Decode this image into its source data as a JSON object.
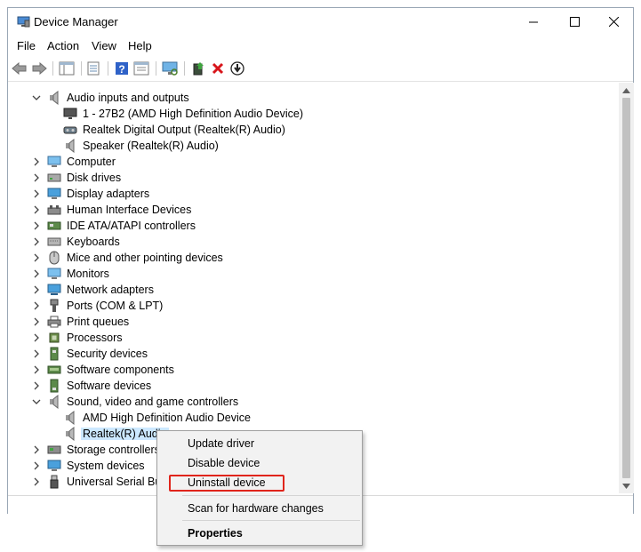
{
  "window": {
    "title": "Device Manager"
  },
  "menu": [
    "File",
    "Action",
    "View",
    "Help"
  ],
  "toolbar": {
    "icons": [
      "back-arrow-icon",
      "forward-arrow-icon",
      "show-hide-console-tree-icon",
      "properties-icon",
      "help-icon",
      "view-icon",
      "monitor-scan-icon",
      "update-driver-icon",
      "uninstall-icon",
      "disable-icon"
    ]
  },
  "tree": [
    {
      "label": "Audio inputs and outputs",
      "level": 0,
      "expanded": true,
      "icon": "speaker-icon"
    },
    {
      "label": "1 - 27B2 (AMD High Definition Audio Device)",
      "level": 1,
      "icon": "monitor-audio-icon"
    },
    {
      "label": "Realtek Digital Output (Realtek(R) Audio)",
      "level": 1,
      "icon": "digital-output-icon"
    },
    {
      "label": "Speaker (Realtek(R) Audio)",
      "level": 1,
      "icon": "speaker-icon"
    },
    {
      "label": "Computer",
      "level": 0,
      "expanded": false,
      "icon": "computer-icon"
    },
    {
      "label": "Disk drives",
      "level": 0,
      "expanded": false,
      "icon": "disk-drive-icon"
    },
    {
      "label": "Display adapters",
      "level": 0,
      "expanded": false,
      "icon": "display-adapter-icon"
    },
    {
      "label": "Human Interface Devices",
      "level": 0,
      "expanded": false,
      "icon": "hid-icon"
    },
    {
      "label": "IDE ATA/ATAPI controllers",
      "level": 0,
      "expanded": false,
      "icon": "ide-controller-icon"
    },
    {
      "label": "Keyboards",
      "level": 0,
      "expanded": false,
      "icon": "keyboard-icon"
    },
    {
      "label": "Mice and other pointing devices",
      "level": 0,
      "expanded": false,
      "icon": "mouse-icon"
    },
    {
      "label": "Monitors",
      "level": 0,
      "expanded": false,
      "icon": "monitor-icon"
    },
    {
      "label": "Network adapters",
      "level": 0,
      "expanded": false,
      "icon": "network-adapter-icon"
    },
    {
      "label": "Ports (COM & LPT)",
      "level": 0,
      "expanded": false,
      "icon": "port-icon"
    },
    {
      "label": "Print queues",
      "level": 0,
      "expanded": false,
      "icon": "printer-icon"
    },
    {
      "label": "Processors",
      "level": 0,
      "expanded": false,
      "icon": "processor-icon"
    },
    {
      "label": "Security devices",
      "level": 0,
      "expanded": false,
      "icon": "security-device-icon"
    },
    {
      "label": "Software components",
      "level": 0,
      "expanded": false,
      "icon": "software-component-icon"
    },
    {
      "label": "Software devices",
      "level": 0,
      "expanded": false,
      "icon": "software-device-icon"
    },
    {
      "label": "Sound, video and game controllers",
      "level": 0,
      "expanded": true,
      "icon": "sound-controller-icon"
    },
    {
      "label": "AMD High Definition Audio Device",
      "level": 1,
      "icon": "speaker-icon"
    },
    {
      "label": "Realtek(R) Audio",
      "level": 1,
      "icon": "speaker-icon",
      "selected": true
    },
    {
      "label": "Storage controllers",
      "level": 0,
      "expanded": false,
      "icon": "storage-controller-icon"
    },
    {
      "label": "System devices",
      "level": 0,
      "expanded": false,
      "icon": "system-device-icon"
    },
    {
      "label": "Universal Serial Bus",
      "level": 0,
      "expanded": false,
      "icon": "usb-icon"
    }
  ],
  "context_menu": {
    "items": [
      {
        "label": "Update driver"
      },
      {
        "label": "Disable device"
      },
      {
        "label": "Uninstall device",
        "highlighted": true
      },
      {
        "label": "Scan for hardware changes"
      },
      {
        "label": "Properties",
        "bold": true
      }
    ]
  },
  "colors": {
    "selection": "#cce8ff",
    "highlight_border": "#e0241b",
    "menu_bg": "#f2f2f2"
  }
}
